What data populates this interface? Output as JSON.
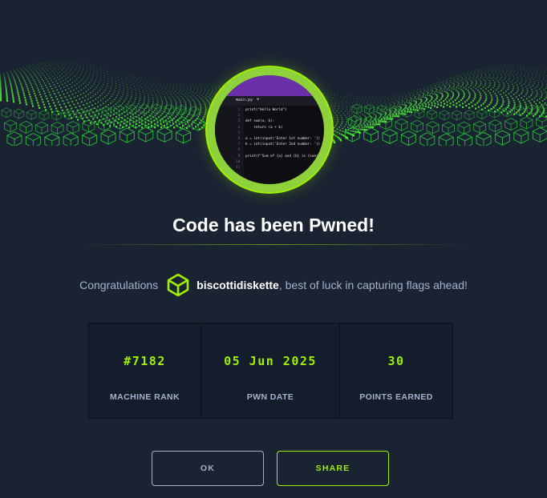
{
  "title": "Code has been Pwned!",
  "message": {
    "prefix": "Congratulations",
    "username": "biscottidiskette",
    "suffix": ", best of luck in capturing flags ahead!"
  },
  "stats": [
    {
      "value": "#7182",
      "label": "MACHINE RANK"
    },
    {
      "value": "05 Jun 2025",
      "label": "PWN DATE"
    },
    {
      "value": "30",
      "label": "POINTS EARNED"
    }
  ],
  "buttons": {
    "ok": "OK",
    "share": "SHARE"
  },
  "avatar": {
    "tab_name": "main.py",
    "tab_plus": "+",
    "line_numbers": "1\n2\n3\n4\n5\n6\n7\n8\n9\n10\n11",
    "code_lines": [
      "print(\"Hello World\")",
      "",
      "def sum(a, b):",
      "    return (a + b)",
      "",
      "a = int(input('Enter 1st number: '))",
      "b = int(input('Enter 2nd number: '))",
      "",
      "print(f'Sum of {a} and {b} is {sum(a,",
      "",
      ""
    ]
  },
  "colors": {
    "accent": "#9fef00",
    "background": "#1a2332",
    "panel": "#141d2b",
    "muted_text": "#a4b1cd"
  },
  "icons": {
    "user_badge": "green-cube-icon",
    "banner": "green-wave-cube-pattern"
  }
}
